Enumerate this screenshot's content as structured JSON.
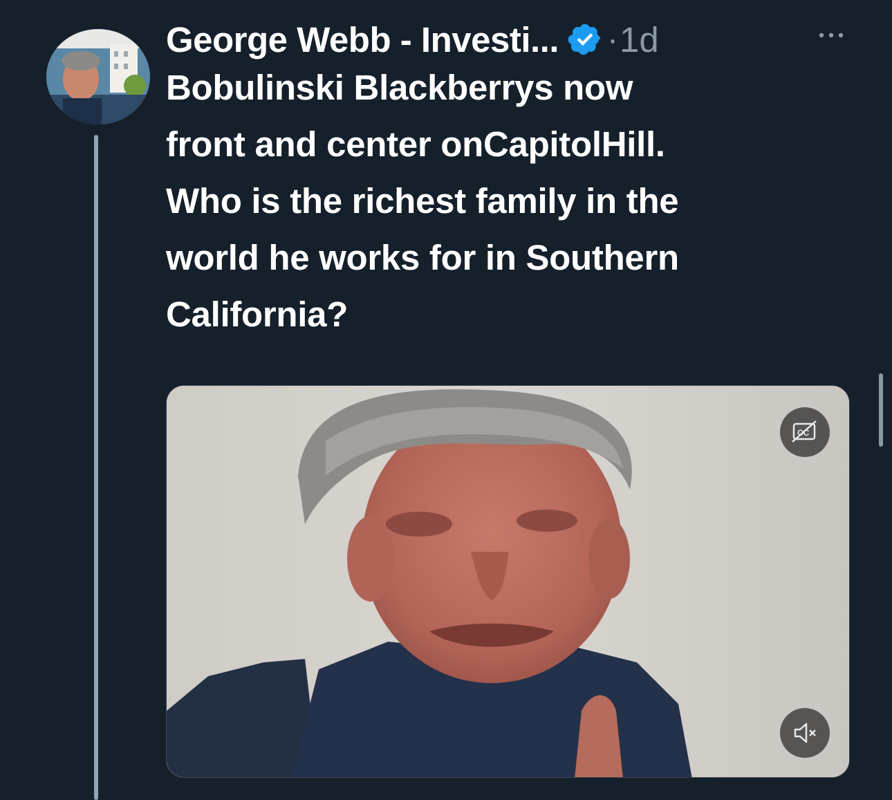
{
  "tweet": {
    "author_name": "George Webb - Investi...",
    "separator": "·",
    "time": "1d",
    "text_lines": [
      "Bobulinski Blackberrys now",
      "front and center onCapitolHill.",
      "Who is the richest family in the",
      "world he works for in Southern",
      "California?"
    ]
  },
  "icons": {
    "verified": "verified-badge-icon",
    "more": "more-options-icon",
    "captions": "closed-captions-off-icon",
    "mute": "volume-muted-icon"
  },
  "colors": {
    "background": "#15202b",
    "verified": "#1d9bf0",
    "secondary_text": "#8b98a5",
    "thread_line": "#8ea5b8"
  }
}
